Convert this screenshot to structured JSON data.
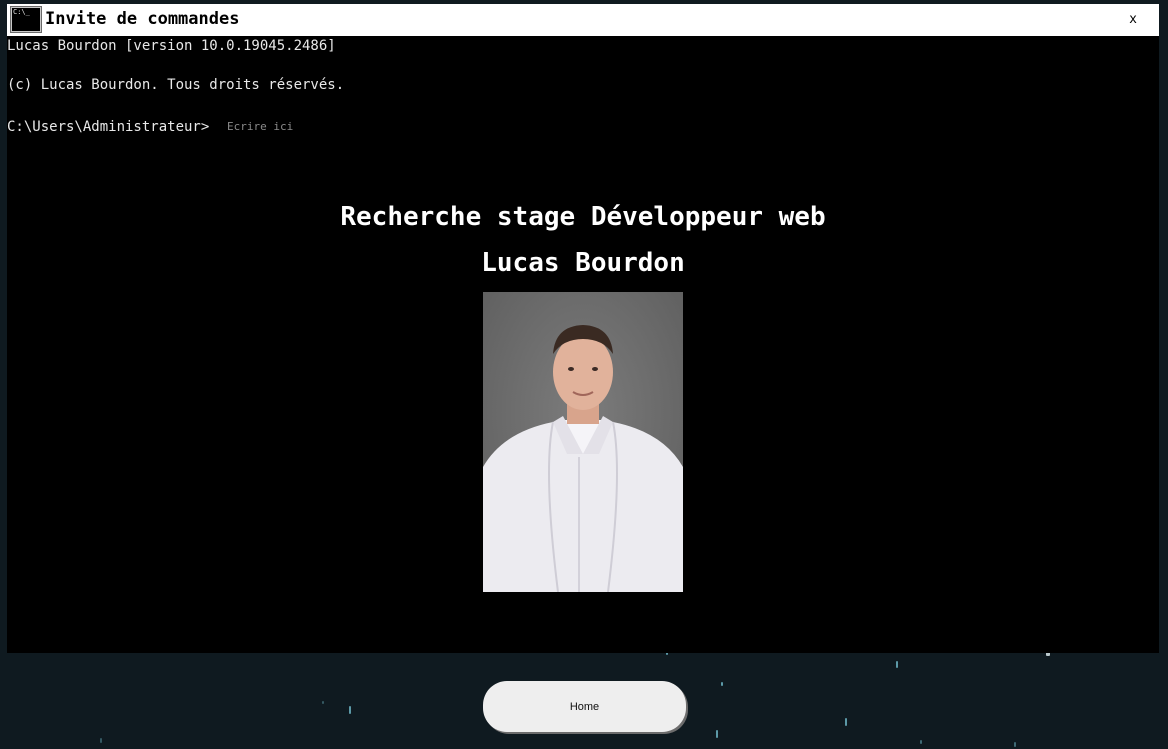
{
  "window": {
    "title": "Invite de commandes",
    "close_label": "x",
    "icon_text": "C:\\_"
  },
  "terminal": {
    "line_version": "Lucas Bourdon [version 10.0.19045.2486]",
    "line_copyright": "(c) Lucas Bourdon. Tous droits réservés.",
    "prompt": "C:\\Users\\Administrateur>",
    "input_placeholder": "Ecrire ici",
    "input_value": ""
  },
  "hero": {
    "headline": "Recherche stage Développeur web",
    "name": "Lucas Bourdon"
  },
  "nav": {
    "home_label": "Home"
  },
  "colors": {
    "page_background": "#0f1a20",
    "terminal_background": "#000000",
    "titlebar_background": "#ffffff",
    "star_color": "#6fb9c9"
  }
}
